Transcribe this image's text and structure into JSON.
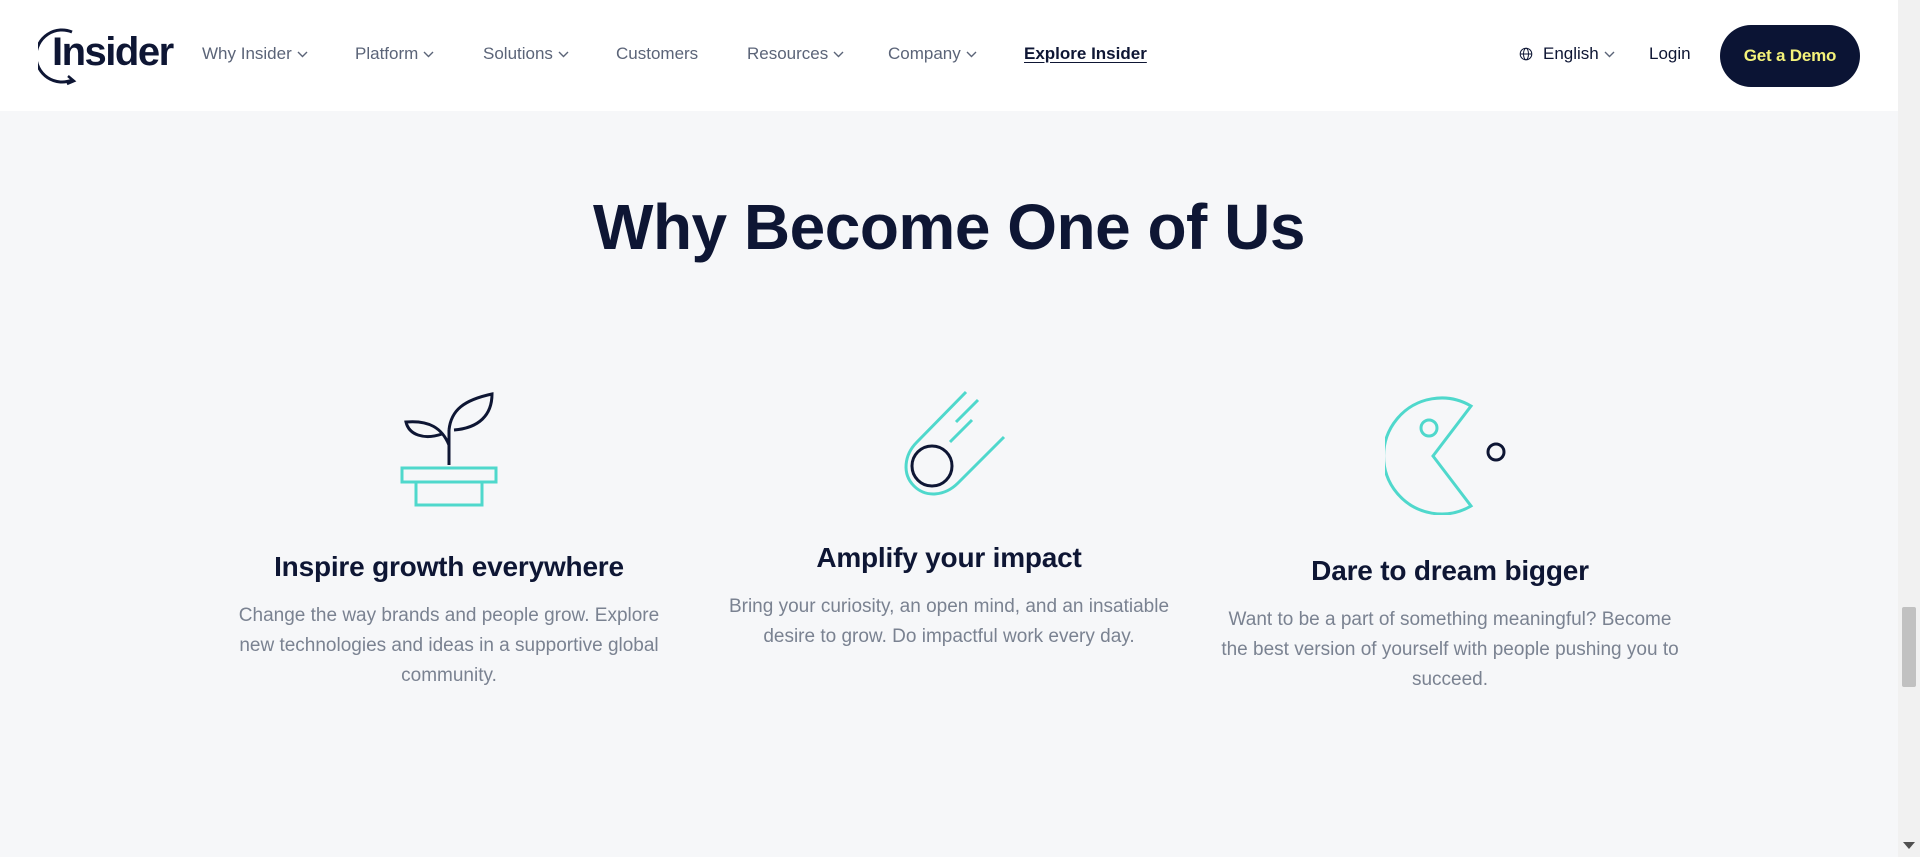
{
  "header": {
    "logo_text": "Insider",
    "nav": [
      {
        "label": "Why Insider",
        "dropdown": true
      },
      {
        "label": "Platform",
        "dropdown": true
      },
      {
        "label": "Solutions",
        "dropdown": true
      },
      {
        "label": "Customers",
        "dropdown": false
      },
      {
        "label": "Resources",
        "dropdown": true
      },
      {
        "label": "Company",
        "dropdown": true
      },
      {
        "label": "Explore Insider",
        "dropdown": false
      }
    ],
    "language": "English",
    "login": "Login",
    "cta": "Get a Demo"
  },
  "section": {
    "title": "Why Become One of Us",
    "cards": [
      {
        "icon": "plant-pot-icon",
        "title": "Inspire growth everywhere",
        "text": "Change the way brands and people grow. Explore new technologies and ideas in a supportive global community."
      },
      {
        "icon": "comet-icon",
        "title": "Amplify your impact",
        "text": "Bring your curiosity, an open mind, and an insatiable desire to grow. Do impactful work every day."
      },
      {
        "icon": "pacman-icon",
        "title": "Dare to dream bigger",
        "text": "Want to be a part of something meaningful? Become the best version of yourself with people pushing you to succeed."
      }
    ]
  },
  "colors": {
    "navy": "#0e1634",
    "teal": "#4fd8cc",
    "cta_text": "#f4f27a",
    "background": "#f6f7f9"
  }
}
